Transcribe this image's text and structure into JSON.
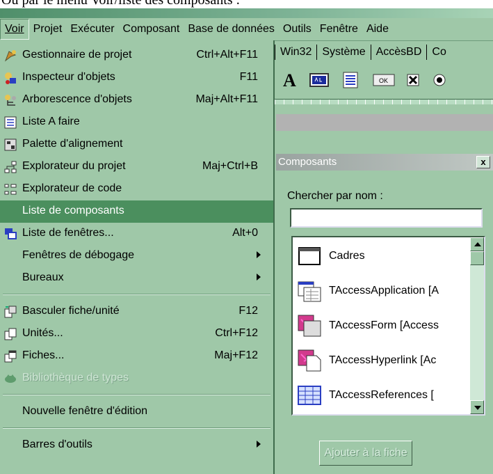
{
  "caption": "Ou par le menu Voir/liste des composants :",
  "menubar": {
    "items": [
      {
        "label": "Voir"
      },
      {
        "label": "Projet"
      },
      {
        "label": "Exécuter"
      },
      {
        "label": "Composant"
      },
      {
        "label": "Base de données"
      },
      {
        "label": "Outils"
      },
      {
        "label": "Fenêtre"
      },
      {
        "label": "Aide"
      }
    ]
  },
  "menu": {
    "items": [
      {
        "label": "Gestionnaire de projet",
        "shortcut": "Ctrl+Alt+F11",
        "icon": "project-manager-icon"
      },
      {
        "label": "Inspecteur d'objets",
        "shortcut": "F11",
        "icon": "object-inspector-icon"
      },
      {
        "label": "Arborescence d'objets",
        "shortcut": "Maj+Alt+F11",
        "icon": "object-tree-icon"
      },
      {
        "label": "Liste A faire",
        "shortcut": "",
        "icon": "todo-list-icon"
      },
      {
        "label": "Palette d'alignement",
        "shortcut": "",
        "icon": "alignment-palette-icon"
      },
      {
        "label": "Explorateur du projet",
        "shortcut": "Maj+Ctrl+B",
        "icon": "project-explorer-icon"
      },
      {
        "label": "Explorateur de code",
        "shortcut": "",
        "icon": "code-explorer-icon"
      },
      {
        "label": "Liste de composants",
        "shortcut": "",
        "icon": ""
      },
      {
        "label": "Liste de fenêtres...",
        "shortcut": "Alt+0",
        "icon": "window-list-icon"
      },
      {
        "label": "Fenêtres de débogage",
        "shortcut": "",
        "icon": ""
      },
      {
        "label": "Bureaux",
        "shortcut": "",
        "icon": ""
      },
      {
        "label": "Basculer fiche/unité",
        "shortcut": "F12",
        "icon": "toggle-form-unit-icon"
      },
      {
        "label": "Unités...",
        "shortcut": "Ctrl+F12",
        "icon": "units-icon"
      },
      {
        "label": "Fiches...",
        "shortcut": "Maj+F12",
        "icon": "forms-icon"
      },
      {
        "label": "Bibliothèque de types",
        "shortcut": "",
        "icon": "type-library-icon"
      },
      {
        "label": "Nouvelle fenêtre d'édition",
        "shortcut": "",
        "icon": ""
      },
      {
        "label": "Barres d'outils",
        "shortcut": "",
        "icon": ""
      }
    ]
  },
  "palette": {
    "tabs": [
      "Win32",
      "Système",
      "AccèsBD",
      "Co"
    ],
    "icons": [
      "label-a-icon",
      "edit-box-icon",
      "memo-icon",
      "ok-button-icon",
      "checkbox-icon",
      "radio-button-icon"
    ]
  },
  "components_window": {
    "title": "Composants",
    "close": "x",
    "search_label": "Chercher par nom :",
    "search_value": "",
    "list": [
      {
        "name": "Cadres",
        "icon": "frame-icon"
      },
      {
        "name": "TAccessApplication  [A",
        "icon": "access-application-icon"
      },
      {
        "name": "TAccessForm  [Access",
        "icon": "access-form-icon"
      },
      {
        "name": "TAccessHyperlink  [Ac",
        "icon": "access-hyperlink-icon"
      },
      {
        "name": "TAccessReferences  [",
        "icon": "access-references-icon"
      }
    ],
    "add_button": "Ajouter à la fiche"
  }
}
